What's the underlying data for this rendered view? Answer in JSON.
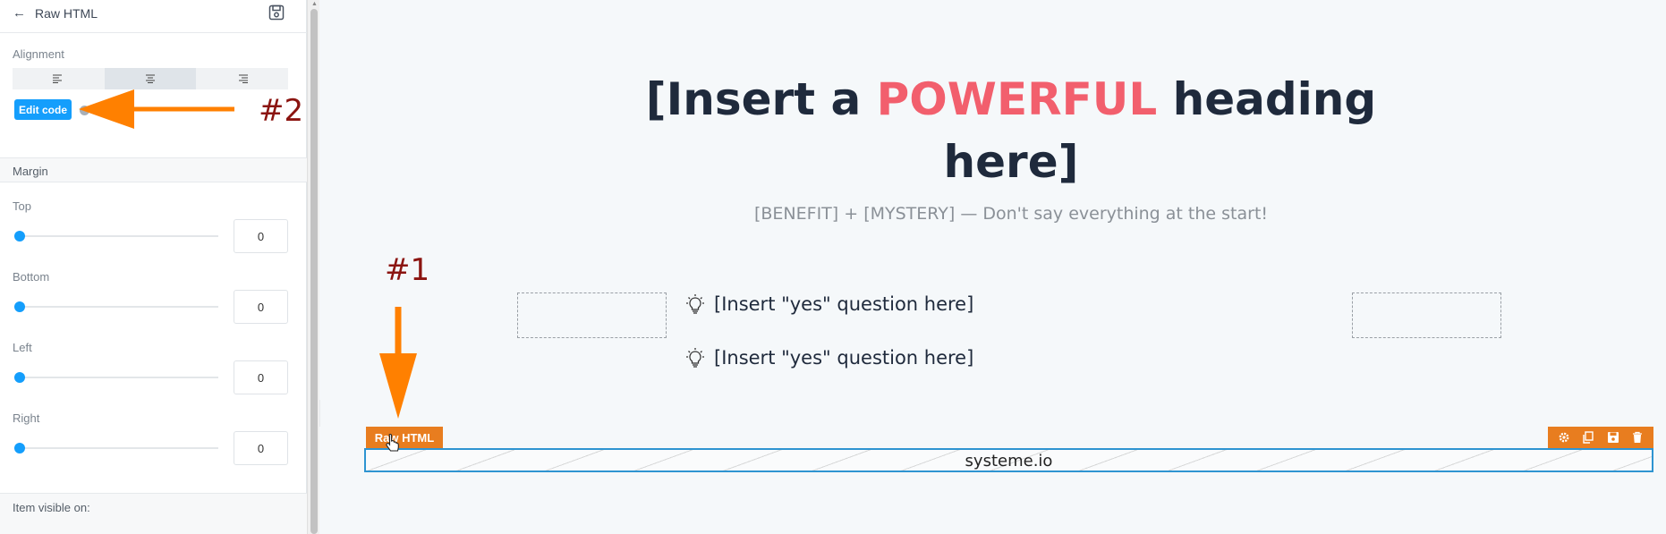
{
  "sidebar": {
    "back_label": "Raw HTML",
    "alignment_label": "Alignment",
    "alignment_options": [
      "left",
      "center",
      "right"
    ],
    "alignment_selected": "center",
    "edit_code_label": "Edit code",
    "margin_label": "Margin",
    "margins": {
      "top": {
        "label": "Top",
        "value": "0"
      },
      "bottom": {
        "label": "Bottom",
        "value": "0"
      },
      "left": {
        "label": "Left",
        "value": "0"
      },
      "right": {
        "label": "Right",
        "value": "0"
      }
    },
    "visible_label": "Item visible on:"
  },
  "canvas": {
    "heading_pre": "[Insert a ",
    "heading_highlight": "POWERFUL",
    "heading_post": " heading here]",
    "subheading": "[BENEFIT] + [MYSTERY] — Don't say everything at the start!",
    "questions": [
      "[Insert \"yes\" question here]",
      "[Insert \"yes\" question here]"
    ],
    "raw_html_tag": "Raw HTML",
    "raw_html_text": "systeme.io",
    "toolbar_icons": [
      "gear-icon",
      "copy-icon",
      "save-icon",
      "trash-icon"
    ]
  },
  "annotations": {
    "label_1": "#1",
    "label_2": "#2"
  },
  "colors": {
    "accent_blue": "#149efc",
    "highlight_red": "#f25f6d",
    "element_orange": "#e87d1f",
    "annotation_arrow": "#ff8000",
    "annotation_text": "#8b1410"
  }
}
